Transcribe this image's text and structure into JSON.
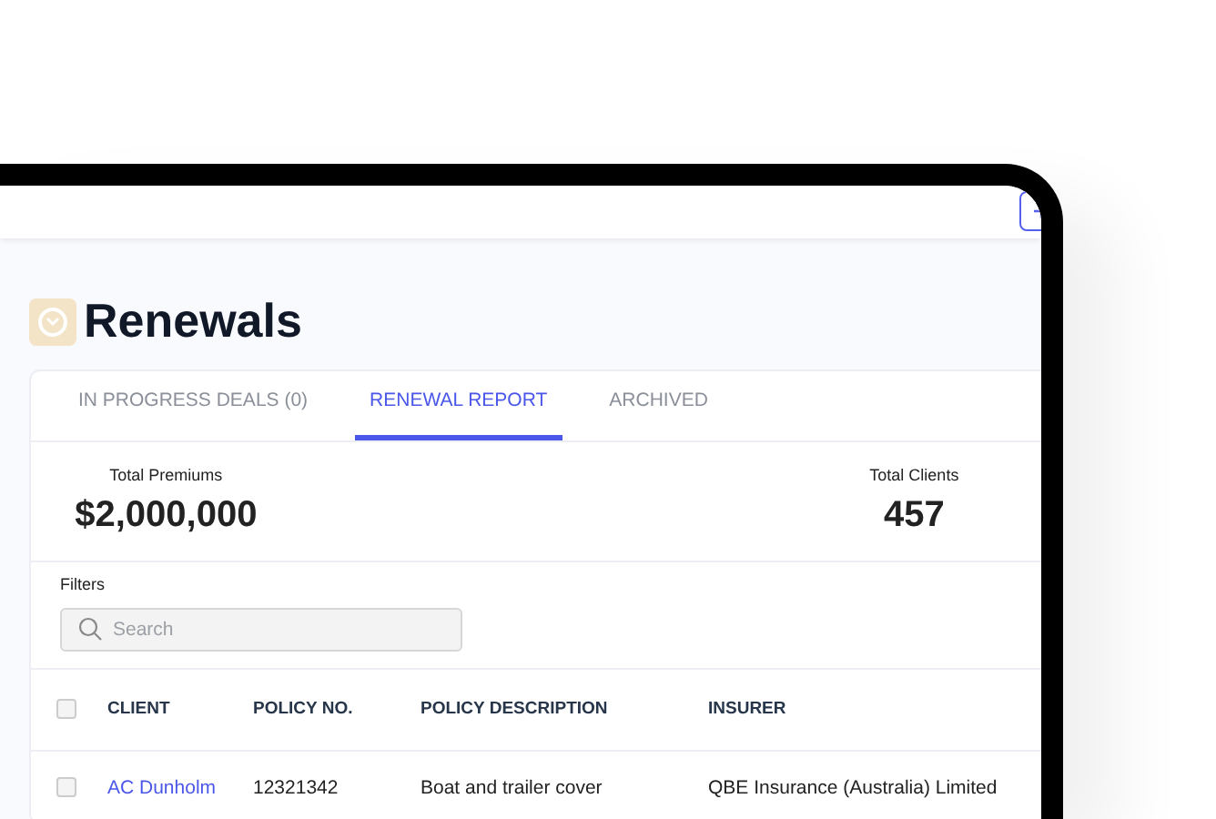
{
  "page": {
    "title": "Renewals"
  },
  "tabs": [
    {
      "label": "IN PROGRESS DEALS (0)",
      "selected": false
    },
    {
      "label": "RENEWAL REPORT",
      "selected": true
    },
    {
      "label": "ARCHIVED",
      "selected": false
    }
  ],
  "stats": [
    {
      "label": "Total Premiums",
      "value": "$2,000,000"
    },
    {
      "label": "Total Clients",
      "value": "457"
    }
  ],
  "filters": {
    "label": "Filters",
    "search": {
      "placeholder": "Search"
    }
  },
  "table": {
    "header_checked": false,
    "columns": [
      "CLIENT",
      "POLICY NO.",
      "POLICY DESCRIPTION",
      "INSURER"
    ],
    "rows": [
      {
        "checked": false,
        "cells": [
          "AC Dunholm",
          "12321342",
          "Boat and trailer cover",
          "QBE Insurance (Australia) Limited"
        ]
      }
    ]
  }
}
